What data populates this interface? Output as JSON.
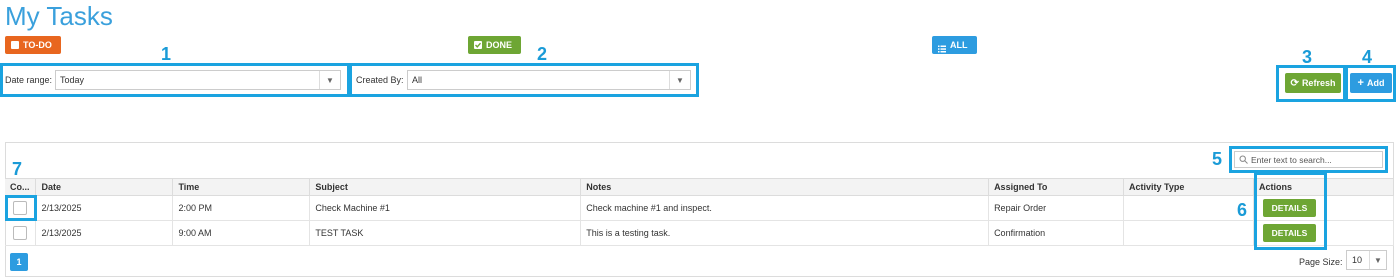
{
  "page_title": "My Tasks",
  "filters": {
    "todo_label": "TO-DO",
    "done_label": "DONE",
    "all_label": "ALL"
  },
  "date_range": {
    "label": "Date range:",
    "value": "Today"
  },
  "created_by": {
    "label": "Created By:",
    "value": "All"
  },
  "toolbar": {
    "refresh_label": "Refresh",
    "add_label": "Add"
  },
  "search": {
    "placeholder": "Enter text to search..."
  },
  "annotations": [
    "1",
    "2",
    "3",
    "4",
    "5",
    "6",
    "7"
  ],
  "table": {
    "columns": [
      "Co...",
      "Date",
      "Time",
      "Subject",
      "Notes",
      "Assigned To",
      "Activity Type",
      "Actions"
    ],
    "rows": [
      {
        "date": "2/13/2025",
        "time": "2:00 PM",
        "subject": "Check Machine #1",
        "notes": "Check machine #1 and inspect.",
        "assigned_to": "Repair Order",
        "activity_type": "",
        "action": "DETAILS"
      },
      {
        "date": "2/13/2025",
        "time": "9:00 AM",
        "subject": "TEST TASK",
        "notes": "This is a testing task.",
        "assigned_to": "Confirmation",
        "activity_type": "",
        "action": "DETAILS"
      }
    ]
  },
  "pager": {
    "current_page": "1",
    "page_size_label": "Page Size:",
    "page_size_value": "10"
  },
  "colors": {
    "accent": "#3aa0dc",
    "todo": "#e8661f",
    "done": "#6ea634",
    "all": "#2d9ce0",
    "highlight": "#1aa3e0"
  }
}
